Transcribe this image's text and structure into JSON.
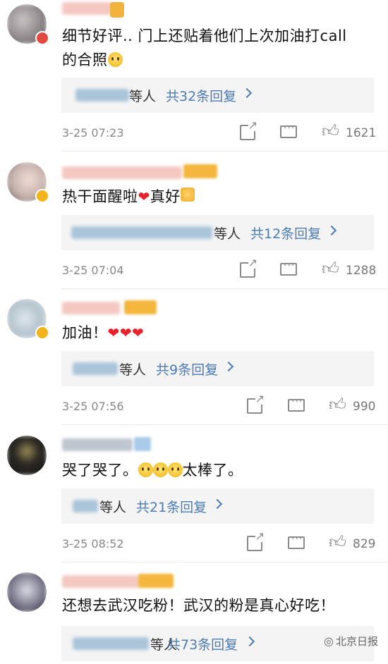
{
  "comments": [
    {
      "text": "细节好评.. 门上还贴着他们上次加油打call",
      "text2": "的合照",
      "reply_who": "等人",
      "reply_count": "共32条回复",
      "time": "3-25 07:23",
      "likes": "1621"
    },
    {
      "text": "热干面醒啦",
      "text_after_heart": "真好",
      "reply_who": "等人",
      "reply_count": "共12条回复",
      "time": "3-25 07:04",
      "likes": "1288"
    },
    {
      "text": "加油！",
      "reply_who": "等人",
      "reply_count": "共9条回复",
      "time": "3-25 07:56",
      "likes": "990"
    },
    {
      "text": "哭了哭了。",
      "text_after_emoji": "太棒了。",
      "reply_who": "等人",
      "reply_count": "共21条回复",
      "time": "3-25 08:52",
      "likes": "829"
    },
    {
      "text": "还想去武汉吃粉！武汉的粉是真心好吃！",
      "reply_who": "等人",
      "reply_count": "共73条回复"
    }
  ],
  "watermark": {
    "icon": "wechat-icon",
    "label": "北京日报"
  },
  "colors": {
    "link": "#4a7bb6",
    "reply_bg": "#f4f4f4",
    "heart": "#e8212a"
  }
}
